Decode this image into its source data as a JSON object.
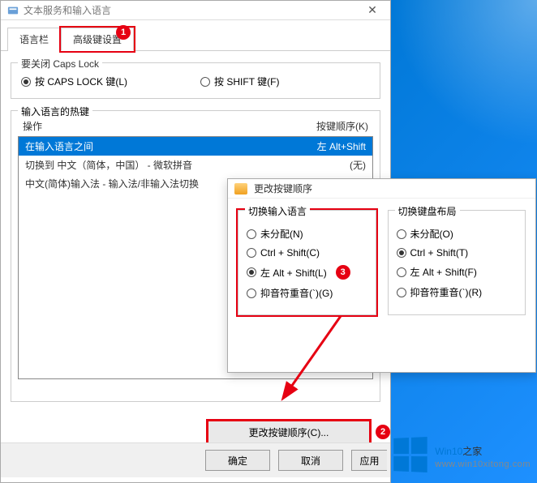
{
  "main": {
    "title": "文本服务和输入语言",
    "tabs": {
      "language_bar": "语言栏",
      "advanced": "高级键设置"
    },
    "capslock": {
      "legend": "要关闭 Caps Lock",
      "opt_capslock": "按 CAPS LOCK 键(L)",
      "opt_shift": "按 SHIFT 键(F)"
    },
    "hotkeys": {
      "legend": "输入语言的热键",
      "col_action": "操作",
      "col_keys": "按键顺序(K)",
      "rows": [
        {
          "action": "在输入语言之间",
          "keys": "左 Alt+Shift"
        },
        {
          "action": "切换到 中文（简体，中国）  - 微软拼音",
          "keys": "(无)"
        },
        {
          "action": "中文(简体)输入法 - 输入法/非输入法切换",
          "keys": ""
        }
      ],
      "change_btn": "更改按键顺序(C)..."
    },
    "buttons": {
      "ok": "确定",
      "cancel": "取消",
      "apply": "应用"
    }
  },
  "secondary": {
    "title": "更改按键顺序",
    "left_group": {
      "legend": "切换输入语言",
      "opts": {
        "none": "未分配(N)",
        "ctrlshift": "Ctrl + Shift(C)",
        "altshift": "左 Alt + Shift(L)",
        "grave": "抑音符重音(`)(G)"
      }
    },
    "right_group": {
      "legend": "切换键盘布局",
      "opts": {
        "none": "未分配(O)",
        "ctrlshift": "Ctrl + Shift(T)",
        "altshift": "左 Alt + Shift(F)",
        "grave": "抑音符重音(`)(R)"
      }
    }
  },
  "badges": {
    "one": "1",
    "two": "2",
    "three": "3"
  },
  "watermark": {
    "brand_a": "Win10",
    "brand_b": "之家",
    "url": "www.win10xitong.com"
  }
}
